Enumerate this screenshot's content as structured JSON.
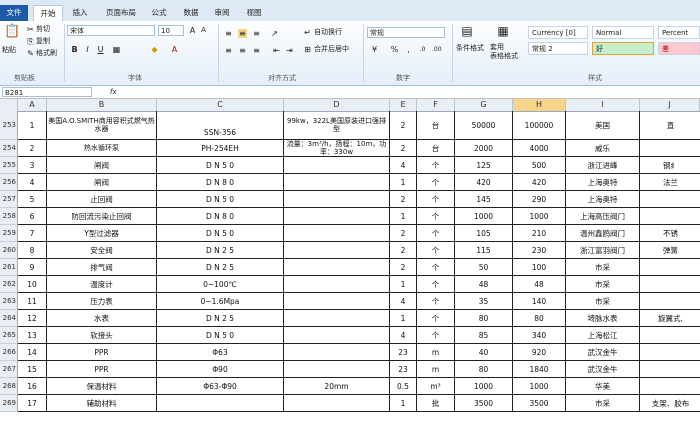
{
  "tabs": [
    "文件",
    "开始",
    "插入",
    "页面布局",
    "公式",
    "数据",
    "审阅",
    "视图"
  ],
  "ribbon": {
    "clipboard": {
      "cut": "剪切",
      "copy": "复制",
      "paste": "粘贴",
      "format_painter": "格式刷",
      "label": "剪贴板"
    },
    "font": {
      "name": "宋体",
      "size": "10",
      "label": "字体"
    },
    "alignment": {
      "wrap": "自动换行",
      "merge": "合并后居中",
      "label": "对齐方式"
    },
    "number": {
      "format": "常规",
      "label": "数字"
    },
    "styles": {
      "conditional": "条件格式",
      "table": "套用\n表格格式",
      "label": "样式",
      "cells": [
        {
          "name": "Currency [0]",
          "bg": "#ffffff"
        },
        {
          "name": "Normal",
          "bg": "#ffffff"
        },
        {
          "name": "Percent",
          "bg": "#ffffff"
        },
        {
          "name": "常规 2",
          "bg": "#ffffff"
        },
        {
          "name": "好",
          "bg": "#c6efce"
        },
        {
          "name": "差",
          "bg": "#ffc7ce"
        }
      ]
    }
  },
  "formula_bar": {
    "name_box": "B281",
    "fx": "fx"
  },
  "columns": [
    "A",
    "B",
    "C",
    "D",
    "E",
    "F",
    "G",
    "H",
    "I",
    "J"
  ],
  "selected_column": "H",
  "rows": [
    {
      "num": "253",
      "a": "1",
      "b": "美国A.O.SMITH商用容积式燃气热水器",
      "c": "SSN-356",
      "d": "99kw，322L美国原装进口强排型",
      "e": "2",
      "f": "台",
      "g": "50000",
      "h": "100000",
      "i": "美国",
      "j": "直"
    },
    {
      "num": "254",
      "a": "2",
      "b": "热水循环泵",
      "c": "PH-254EH",
      "d": "流量：3m³/h，扬程：10m，功率：330w",
      "e": "2",
      "f": "台",
      "g": "2000",
      "h": "4000",
      "i": "威乐",
      "j": ""
    },
    {
      "num": "255",
      "a": "3",
      "b": "闸阀",
      "c": "D N 5 0",
      "d": "",
      "e": "4",
      "f": "个",
      "g": "125",
      "h": "500",
      "i": "浙江进峰",
      "j": "钢纟"
    },
    {
      "num": "256",
      "a": "4",
      "b": "闸阀",
      "c": "D N 8 0",
      "d": "",
      "e": "1",
      "f": "个",
      "g": "420",
      "h": "420",
      "i": "上海奥特",
      "j": "法兰"
    },
    {
      "num": "257",
      "a": "5",
      "b": "止回阀",
      "c": "D N 5 0",
      "d": "",
      "e": "2",
      "f": "个",
      "g": "145",
      "h": "290",
      "i": "上海奥特",
      "j": ""
    },
    {
      "num": "258",
      "a": "6",
      "b": "防回流污染止回阀",
      "c": "D N 8 0",
      "d": "",
      "e": "1",
      "f": "个",
      "g": "1000",
      "h": "1000",
      "i": "上海高压阀门",
      "j": ""
    },
    {
      "num": "259",
      "a": "7",
      "b": "Y型过滤器",
      "c": "D N 5 0",
      "d": "",
      "e": "2",
      "f": "个",
      "g": "105",
      "h": "210",
      "i": "温州鑫鸥阀门",
      "j": "不锈"
    },
    {
      "num": "260",
      "a": "8",
      "b": "安全阀",
      "c": "D N 2 5",
      "d": "",
      "e": "2",
      "f": "个",
      "g": "115",
      "h": "230",
      "i": "浙江富羽阀门",
      "j": "弹簧"
    },
    {
      "num": "261",
      "a": "9",
      "b": "排气阀",
      "c": "D N 2 5",
      "d": "",
      "e": "2",
      "f": "个",
      "g": "50",
      "h": "100",
      "i": "市采",
      "j": ""
    },
    {
      "num": "262",
      "a": "10",
      "b": "温度计",
      "c": "0~100℃",
      "d": "",
      "e": "1",
      "f": "个",
      "g": "48",
      "h": "48",
      "i": "市采",
      "j": ""
    },
    {
      "num": "263",
      "a": "11",
      "b": "压力表",
      "c": "0~1.6Mpa",
      "d": "",
      "e": "4",
      "f": "个",
      "g": "35",
      "h": "140",
      "i": "市采",
      "j": ""
    },
    {
      "num": "264",
      "a": "12",
      "b": "水表",
      "c": "D N 2 5",
      "d": "",
      "e": "1",
      "f": "个",
      "g": "80",
      "h": "80",
      "i": "埼脉水表",
      "j": "旋翼式,"
    },
    {
      "num": "265",
      "a": "13",
      "b": "软接头",
      "c": "D N 5 0",
      "d": "",
      "e": "4",
      "f": "个",
      "g": "85",
      "h": "340",
      "i": "上海松江",
      "j": ""
    },
    {
      "num": "266",
      "a": "14",
      "b": "PPR",
      "c": "Φ63",
      "d": "",
      "e": "23",
      "f": "m",
      "g": "40",
      "h": "920",
      "i": "武汉金牛",
      "j": ""
    },
    {
      "num": "267",
      "a": "15",
      "b": "PPR",
      "c": "Φ90",
      "d": "",
      "e": "23",
      "f": "m",
      "g": "80",
      "h": "1840",
      "i": "武汉金牛",
      "j": ""
    },
    {
      "num": "268",
      "a": "16",
      "b": "保温材料",
      "c": "Φ63-Φ90",
      "d": "20mm",
      "e": "0.5",
      "f": "m³",
      "g": "1000",
      "h": "1000",
      "i": "华美",
      "j": ""
    },
    {
      "num": "269",
      "a": "17",
      "b": "辅助材料",
      "c": "",
      "d": "",
      "e": "1",
      "f": "批",
      "g": "3500",
      "h": "3500",
      "i": "市采",
      "j": "支架、胶布"
    }
  ]
}
